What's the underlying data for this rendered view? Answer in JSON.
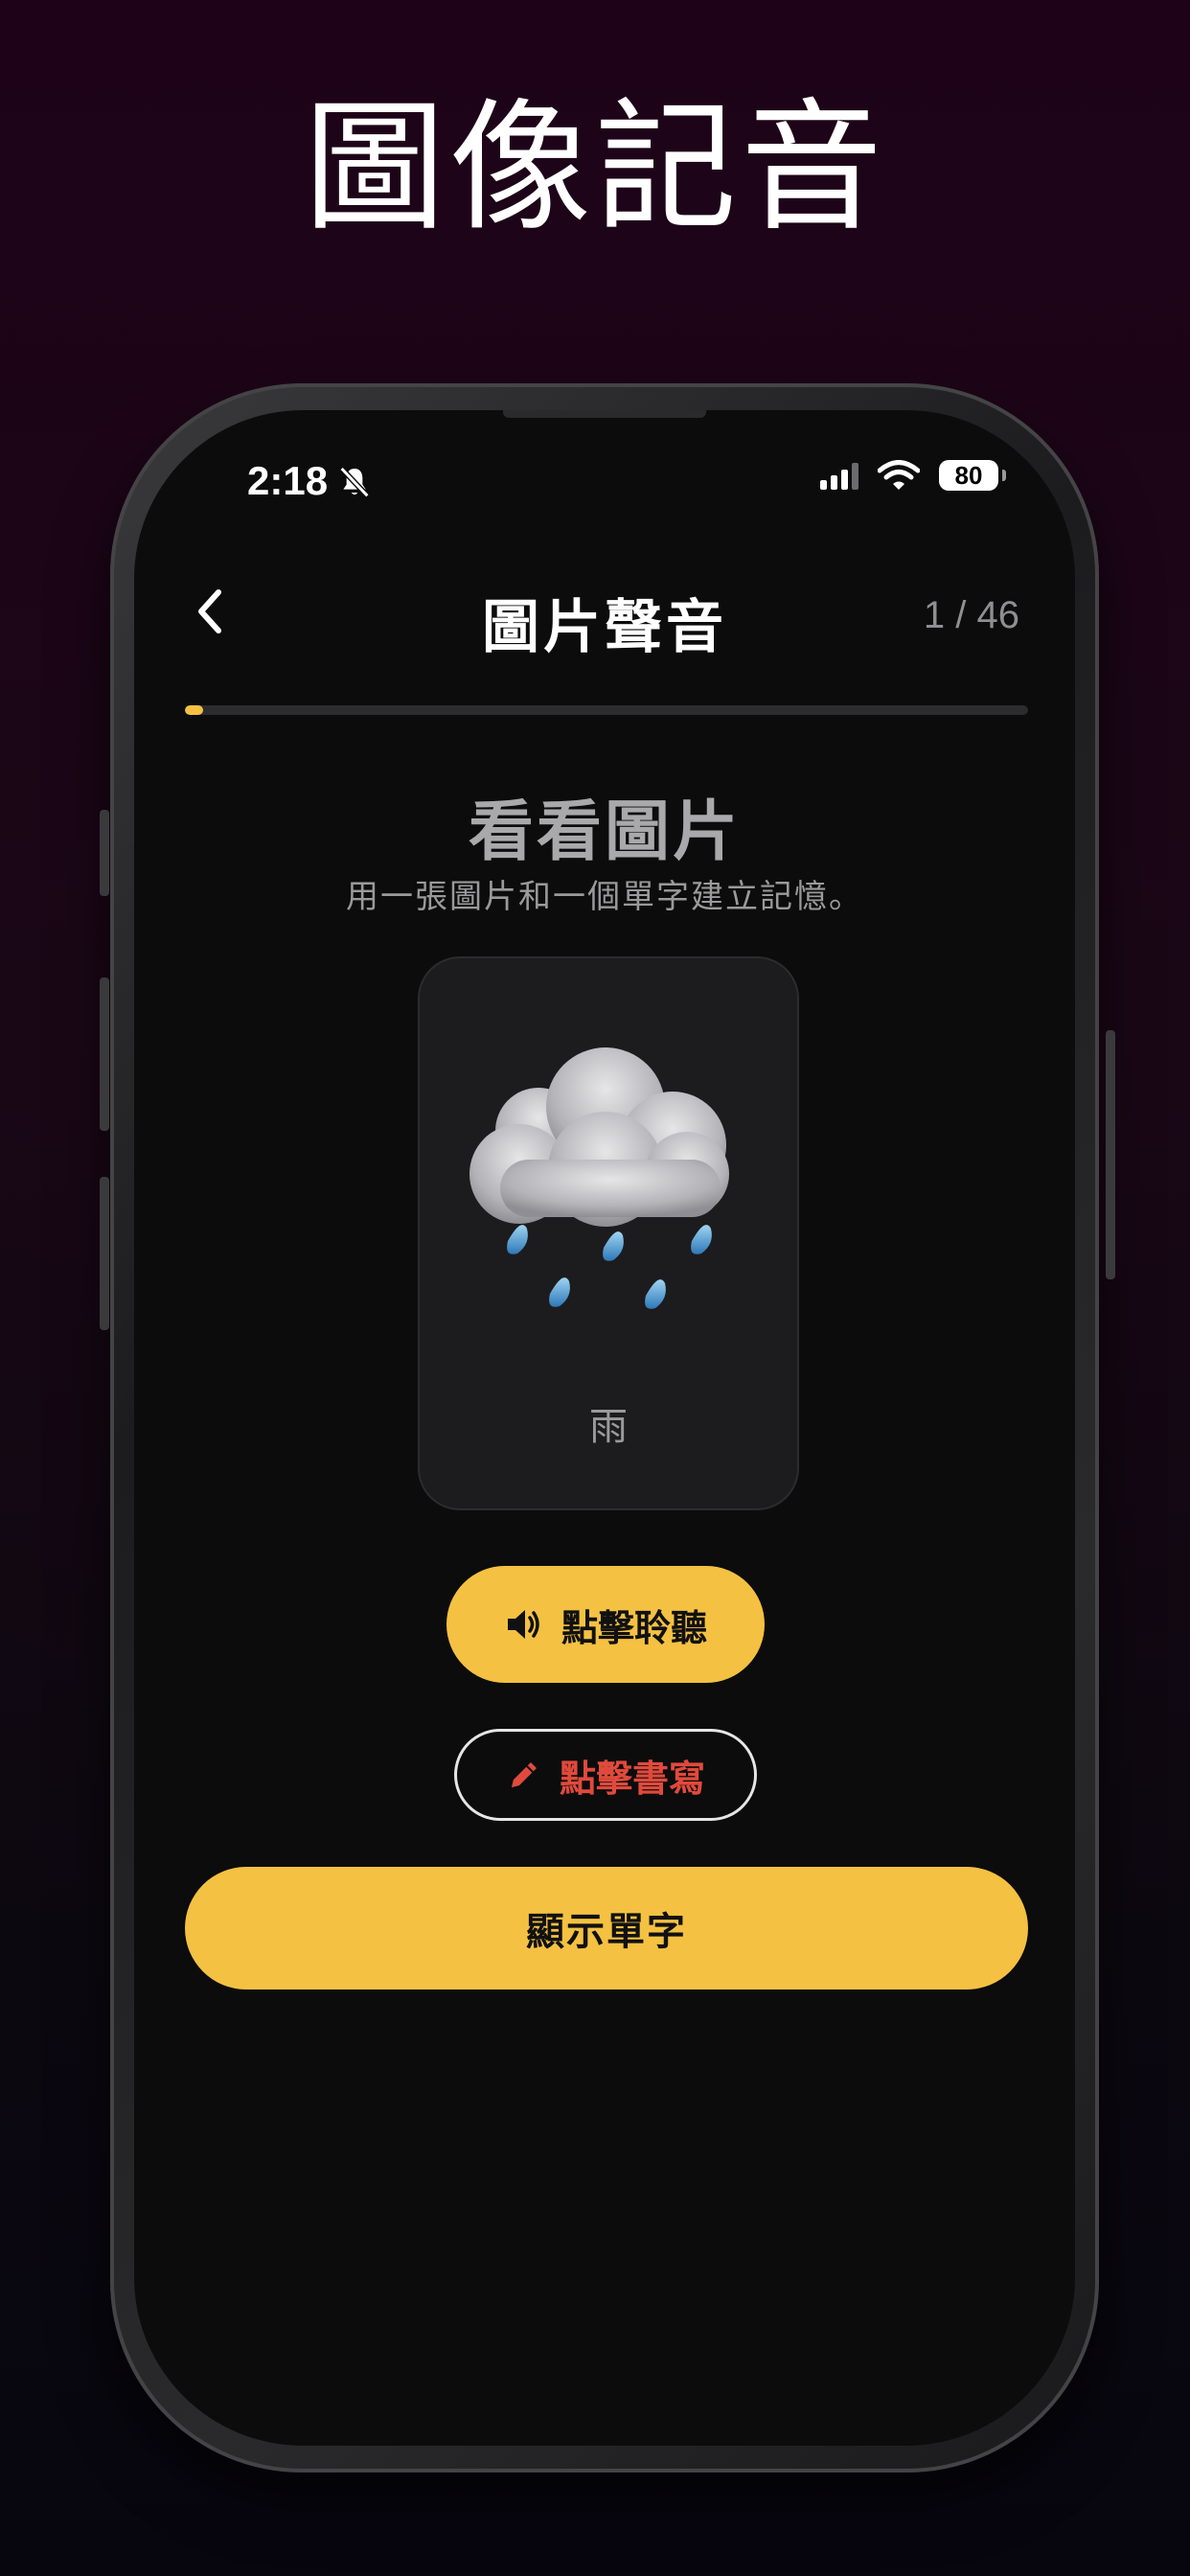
{
  "promo": {
    "headline": "圖像記音"
  },
  "status_bar": {
    "time": "2:18",
    "battery": "80",
    "bell_icon": "bell-slash-icon",
    "signal_icon": "cellular-signal-icon",
    "wifi_icon": "wifi-icon"
  },
  "header": {
    "back_icon": "chevron-left-icon",
    "title": "圖片聲音",
    "counter": "1 / 46"
  },
  "progress": {
    "current": 1,
    "total": 46,
    "fraction": 0.0217,
    "color": "#f4c142"
  },
  "section": {
    "title": "看看圖片",
    "subtitle": "用一張圖片和一個單字建立記憶。"
  },
  "card": {
    "image_icon": "cloud-with-rain-icon",
    "word": "雨"
  },
  "actions": {
    "listen_label": "點擊聆聽",
    "listen_icon": "speaker-icon",
    "write_label": "點擊書寫",
    "write_icon": "pencil-icon",
    "reveal_label": "顯示單字"
  },
  "colors": {
    "accent": "#f4c142",
    "write_text": "#e04a3c",
    "screen_bg": "#0c0c0c"
  }
}
